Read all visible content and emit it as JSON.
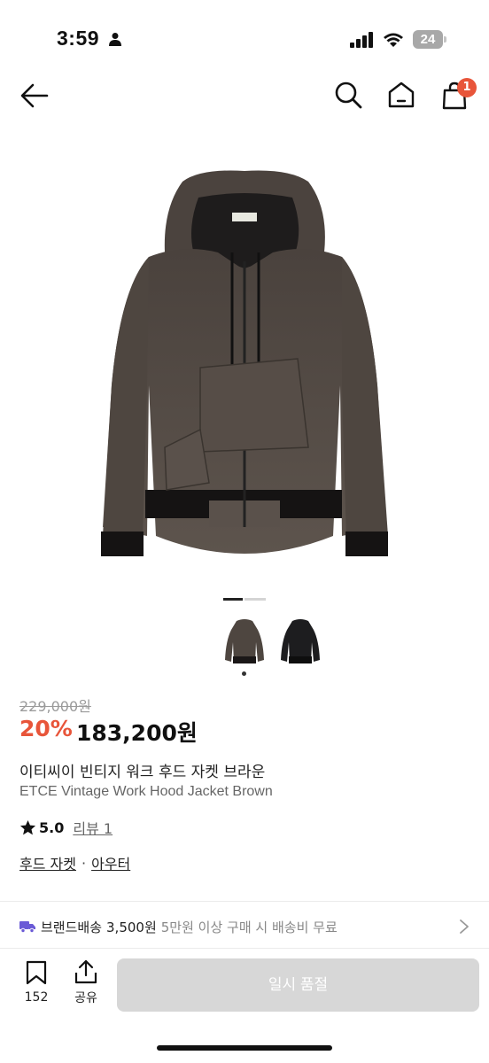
{
  "status_bar": {
    "time": "3:59",
    "battery": "24"
  },
  "nav": {
    "cart_count": "1"
  },
  "gallery": {
    "thumbnails": [
      "brown-jacket-thumb",
      "black-jacket-thumb"
    ]
  },
  "product": {
    "original_price": "229,000원",
    "discount": "20%",
    "price": "183,200원",
    "name_ko": "이티씨이 빈티지 워크 후드 자켓 브라운",
    "name_en": "ETCE Vintage Work Hood Jacket Brown",
    "rating": "5.0",
    "review_label": "리뷰 1",
    "category_1": "후드 자켓",
    "category_sep": "·",
    "category_2": "아우터"
  },
  "shipping": {
    "label": "브랜드배송",
    "fee": "3,500원",
    "note": "5만원 이상 구매 시 배송비 무료"
  },
  "bottom_bar": {
    "bookmark_count": "152",
    "share_label": "공유",
    "cta_label": "일시 품절"
  },
  "colors": {
    "accent": "#e8553a",
    "disabled_button": "#d7d7d7",
    "shipping_icon": "#6a5ad6"
  },
  "icons": [
    "back-arrow-icon",
    "search-icon",
    "home-icon",
    "cart-icon",
    "truck-icon",
    "chevron-right-icon",
    "bookmark-icon",
    "share-icon",
    "star-icon"
  ]
}
